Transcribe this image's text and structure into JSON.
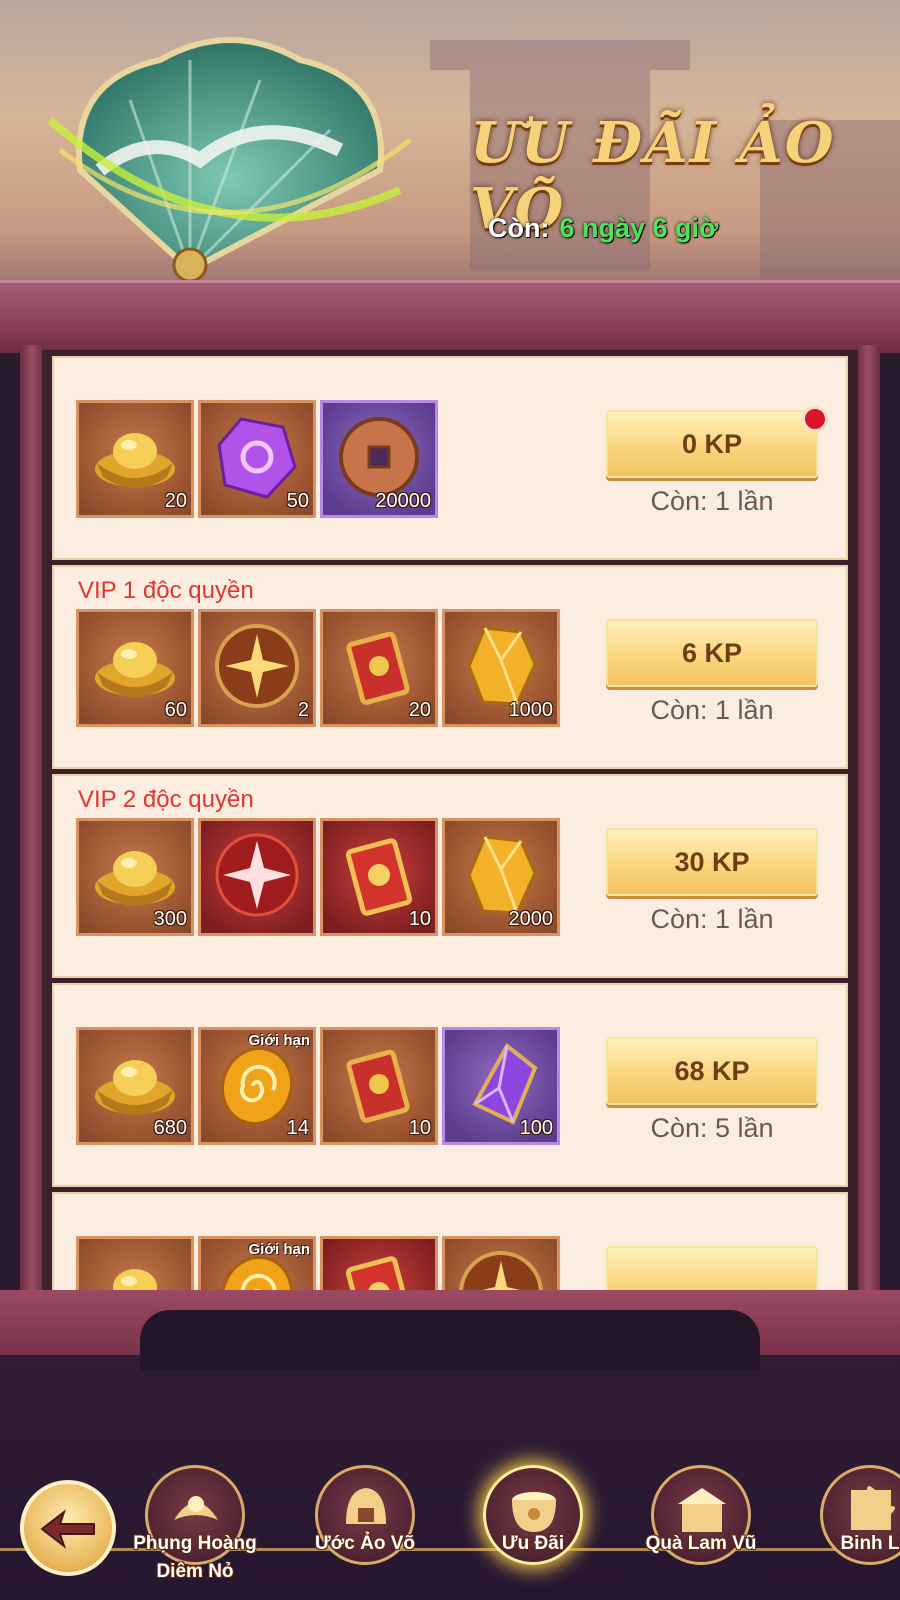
{
  "event": {
    "title": "ƯU ĐÃI ẢO VÕ",
    "countdown_label": "Còn:",
    "countdown_value": "6 ngày 6 giờ"
  },
  "offers": [
    {
      "vip_label": "",
      "items": [
        {
          "icon": "gold-ingot-icon",
          "qty": "20"
        },
        {
          "icon": "purple-gem-icon",
          "qty": "50"
        },
        {
          "icon": "bronze-coin-icon",
          "qty": "20000",
          "frame": "purple"
        }
      ],
      "price": "0 KP",
      "remaining": "Còn: 1 lần",
      "notification_dot": true
    },
    {
      "vip_label": "VIP 1 độc quyền",
      "items": [
        {
          "icon": "gold-ingot-icon",
          "qty": "60"
        },
        {
          "icon": "golden-orb-icon",
          "qty": "2"
        },
        {
          "icon": "talisman-icon",
          "qty": "20"
        },
        {
          "icon": "amber-crystal-icon",
          "qty": "1000"
        }
      ],
      "price": "6 KP",
      "remaining": "Còn: 1 lần"
    },
    {
      "vip_label": "VIP 2 độc quyền",
      "items": [
        {
          "icon": "gold-ingot-icon",
          "qty": "300"
        },
        {
          "icon": "red-orb-icon",
          "qty": "",
          "frame": "red"
        },
        {
          "icon": "red-talisman-icon",
          "qty": "10",
          "frame": "red"
        },
        {
          "icon": "amber-crystal-icon",
          "qty": "2000"
        }
      ],
      "price": "30 KP",
      "remaining": "Còn: 1 lần"
    },
    {
      "vip_label": "",
      "items": [
        {
          "icon": "gold-ingot-icon",
          "qty": "680"
        },
        {
          "icon": "swirl-stone-icon",
          "qty": "14",
          "limit": "Giới hạn"
        },
        {
          "icon": "talisman-icon",
          "qty": "10"
        },
        {
          "icon": "violet-crystal-icon",
          "qty": "100",
          "frame": "purple"
        }
      ],
      "price": "68 KP",
      "remaining": "Còn: 5 lần"
    },
    {
      "vip_label": "",
      "items": [
        {
          "icon": "gold-ingot-icon",
          "qty": ""
        },
        {
          "icon": "swirl-stone-icon",
          "qty": "",
          "limit": "Giới hạn"
        },
        {
          "icon": "red-talisman-icon",
          "qty": "",
          "frame": "red"
        },
        {
          "icon": "golden-orb-icon",
          "qty": ""
        }
      ],
      "price": "",
      "remaining": ""
    }
  ],
  "nav": {
    "back_icon": "back-arrow-icon",
    "tabs": [
      {
        "label": "Phụng Hoàng Diêm Nỏ",
        "icon": "phoenix-crossbow-icon",
        "active": false
      },
      {
        "label": "Ước Ảo Võ",
        "icon": "helmet-icon",
        "active": false
      },
      {
        "label": "Ưu Đãi",
        "icon": "treasure-pot-icon",
        "active": true
      },
      {
        "label": "Quà Lam Vũ",
        "icon": "gift-palace-icon",
        "active": false
      },
      {
        "label": "Binh L",
        "icon": "puzzle-icon",
        "active": false
      }
    ]
  },
  "colors": {
    "accent_gold": "#f6d37a",
    "timer_green": "#4ee35a",
    "vip_red": "#e2352f",
    "frame_purple": "#b88ae8"
  }
}
